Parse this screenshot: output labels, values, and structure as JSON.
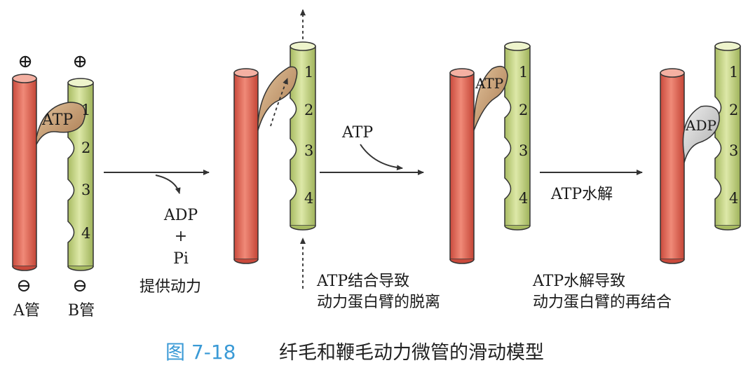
{
  "panel1": {
    "plus_sign": "⊕",
    "minus_sign": "⊖",
    "label_a": "A管",
    "label_b": "B管",
    "arm_label": "ATP",
    "numbers": [
      "1",
      "2",
      "3",
      "4"
    ]
  },
  "step1": {
    "line1": "ADP",
    "line2": "+",
    "line3": "Pi",
    "line4": "提供动力"
  },
  "panel2": {
    "numbers": [
      "1",
      "2",
      "3",
      "4"
    ]
  },
  "step2": {
    "label": "ATP",
    "note_line1": "ATP结合导致",
    "note_line2": "动力蛋白臂的脱离"
  },
  "panel3": {
    "arm_label": "ATP",
    "numbers": [
      "1",
      "2",
      "3",
      "4"
    ]
  },
  "step3": {
    "label": "ATP水解",
    "note_line1": "ATP水解导致",
    "note_line2": "动力蛋白臂的再结合"
  },
  "panel4": {
    "arm_label": "ADP",
    "numbers": [
      "1",
      "2",
      "3",
      "4"
    ]
  },
  "caption": {
    "figure_no": "图 7-18",
    "title": "纤毛和鞭毛动力微管的滑动模型"
  },
  "colors": {
    "a_tube": "#e8705e",
    "b_tube": "#c9d98a",
    "arm_atp": "#c9a27a",
    "arm_adp": "#d2d2d2",
    "caption_blue": "#3a9ad6"
  }
}
